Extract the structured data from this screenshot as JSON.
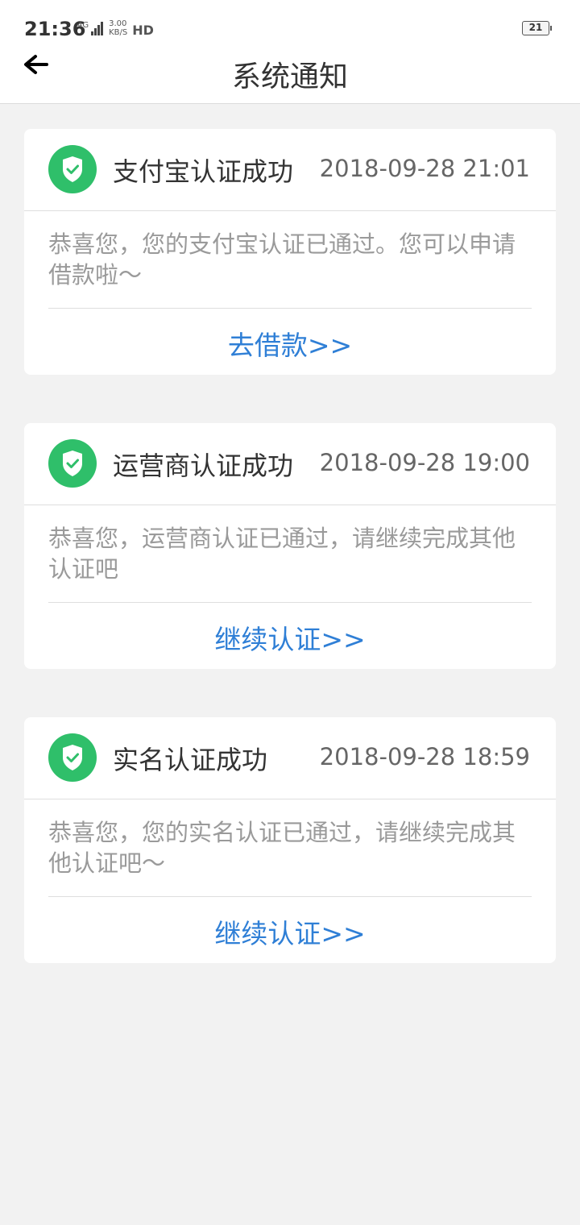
{
  "status_bar": {
    "time": "21:36",
    "network": "4G",
    "speed_value": "3.00",
    "speed_unit": "KB/S",
    "hd_label": "HD",
    "battery": "21"
  },
  "header": {
    "back_icon": "arrow-left-icon",
    "title": "系统通知"
  },
  "notifications": [
    {
      "icon": "shield-check-icon",
      "title": "支付宝认证成功",
      "time": "2018-09-28 21:01",
      "message": "恭喜您，您的支付宝认证已通过。您可以申请借款啦～",
      "action": "去借款>>"
    },
    {
      "icon": "shield-check-icon",
      "title": "运营商认证成功",
      "time": "2018-09-28 19:00",
      "message": "恭喜您，运营商认证已通过，请继续完成其他认证吧",
      "action": "继续认证>>"
    },
    {
      "icon": "shield-check-icon",
      "title": "实名认证成功",
      "time": "2018-09-28 18:59",
      "message": "恭喜您，您的实名认证已通过，请继续完成其他认证吧～",
      "action": "继续认证>>"
    }
  ],
  "colors": {
    "accent_link": "#2f7fd6",
    "badge_green": "#2fbf6a",
    "background": "#f2f2f2"
  }
}
